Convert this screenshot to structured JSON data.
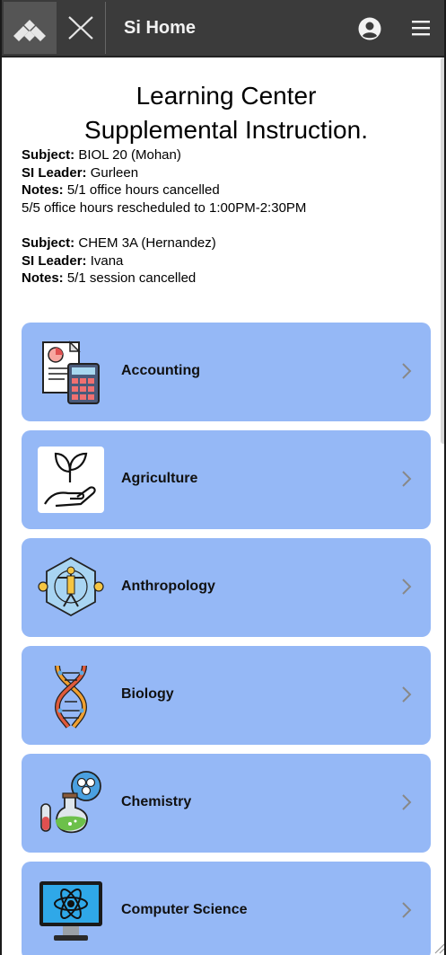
{
  "header": {
    "title": "Si Home",
    "logo_icon": "logo-icon",
    "x_icon": "x-icon",
    "user_icon": "user-icon",
    "menu_icon": "menu-icon"
  },
  "page": {
    "title_line1": "Learning Center",
    "title_line2": "Supplemental Instruction."
  },
  "notices": [
    {
      "subject_label": "Subject:",
      "subject": "BIOL 20 (Mohan)",
      "leader_label": "SI Leader:",
      "leader": "Gurleen",
      "notes_label": "Notes:",
      "notes": "5/1 office hours cancelled",
      "notes_extra": "5/5 office hours rescheduled to 1:00PM-2:30PM"
    },
    {
      "subject_label": "Subject:",
      "subject": "CHEM 3A (Hernandez)",
      "leader_label": "SI Leader:",
      "leader": "Ivana",
      "notes_label": "Notes:",
      "notes": "5/1 session cancelled"
    }
  ],
  "subjects": [
    {
      "label": "Accounting",
      "icon": "accounting-icon"
    },
    {
      "label": "Agriculture",
      "icon": "agriculture-icon"
    },
    {
      "label": "Anthropology",
      "icon": "anthropology-icon"
    },
    {
      "label": "Biology",
      "icon": "dna-icon"
    },
    {
      "label": "Chemistry",
      "icon": "chemistry-icon"
    },
    {
      "label": "Computer Science",
      "icon": "computer-science-icon"
    }
  ],
  "colors": {
    "header_bg": "#3b3b3b",
    "card_bg": "#95b8f6",
    "text": "#000000"
  }
}
